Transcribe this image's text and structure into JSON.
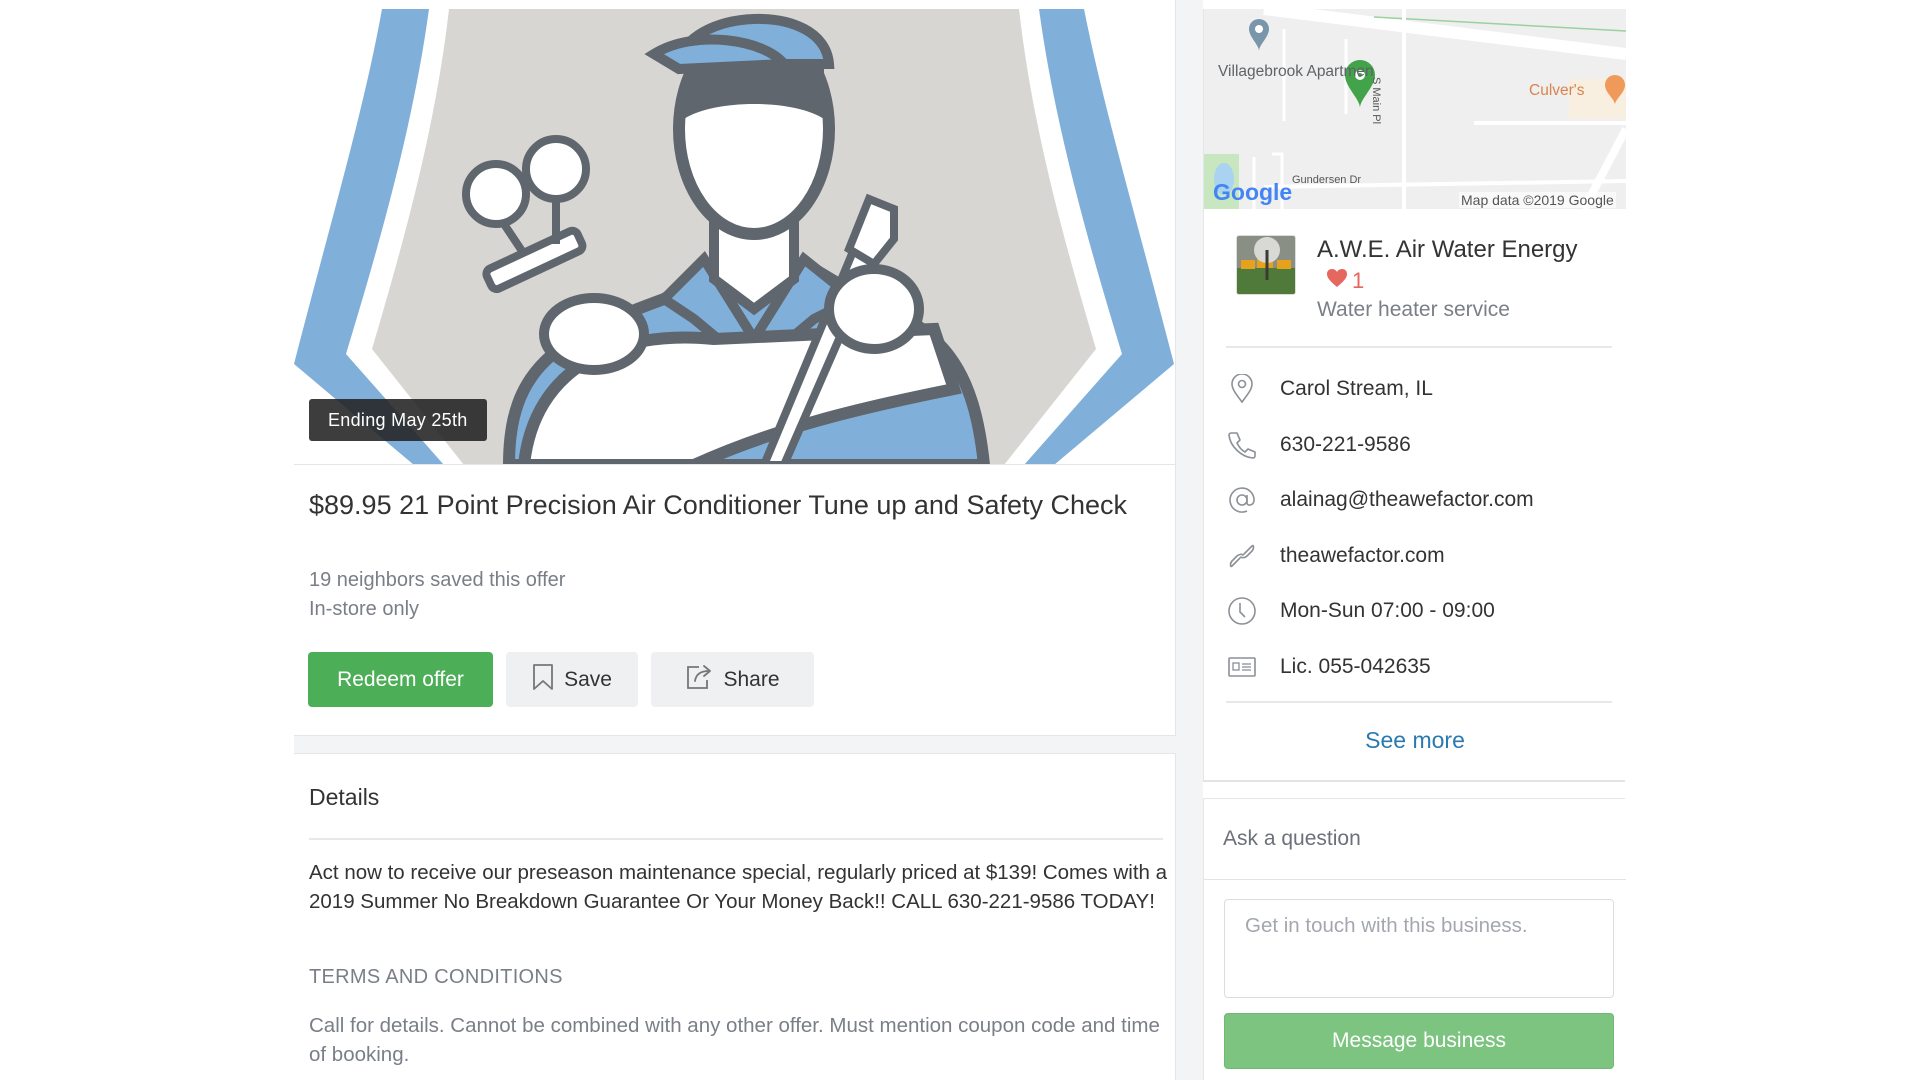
{
  "offer": {
    "badge": "Ending May 25th",
    "title": "$89.95 21 Point Precision Air Conditioner Tune up and Safety Check",
    "saved_count_text": "19 neighbors saved this offer",
    "availability": "In-store only",
    "hero_image": "hvac-technician-illustration",
    "buttons": {
      "redeem": "Redeem offer",
      "save": "Save",
      "share": "Share"
    }
  },
  "details": {
    "heading": "Details",
    "body": "Act now to receive our preseason maintenance special, regularly priced at $139! Comes with a 2019 Summer No Breakdown Guarantee Or Your Money Back!! CALL 630-221-9586 TODAY!",
    "terms_heading": "TERMS AND CONDITIONS",
    "terms_body": "Call for details. Cannot be combined with any other offer. Must mention coupon code and time of booking."
  },
  "map": {
    "labels": {
      "apartments": "Villagebrook Apartmen",
      "restaurant": "Culver's",
      "street_vertical": "S Main Pl",
      "street_horizontal": "Gundersen Dr",
      "logo": "Google",
      "attribution": "Map data ©2019 Google"
    }
  },
  "business": {
    "name": "A.W.E. Air Water Energy",
    "likes": "1",
    "category": "Water heater service",
    "info": [
      {
        "icon": "location-pin-icon",
        "text": "Carol Stream, IL"
      },
      {
        "icon": "phone-icon",
        "text": "630-221-9586"
      },
      {
        "icon": "at-sign-icon",
        "text": "alainag@theawefactor.com"
      },
      {
        "icon": "link-icon",
        "text": "theawefactor.com"
      },
      {
        "icon": "clock-icon",
        "text": "Mon-Sun 07:00 - 09:00"
      },
      {
        "icon": "license-card-icon",
        "text": "Lic. 055-042635"
      }
    ],
    "see_more": "See more"
  },
  "ask": {
    "title": "Ask a question",
    "input_value": "",
    "placeholder": "Get in touch with this business.",
    "button": "Message business"
  },
  "colors": {
    "primary_green": "#4caf57",
    "disabled_green": "#7cc47f",
    "link_blue": "#2a7ab0",
    "heart_red": "#e5675e",
    "secondary_text": "#7a7f87"
  }
}
